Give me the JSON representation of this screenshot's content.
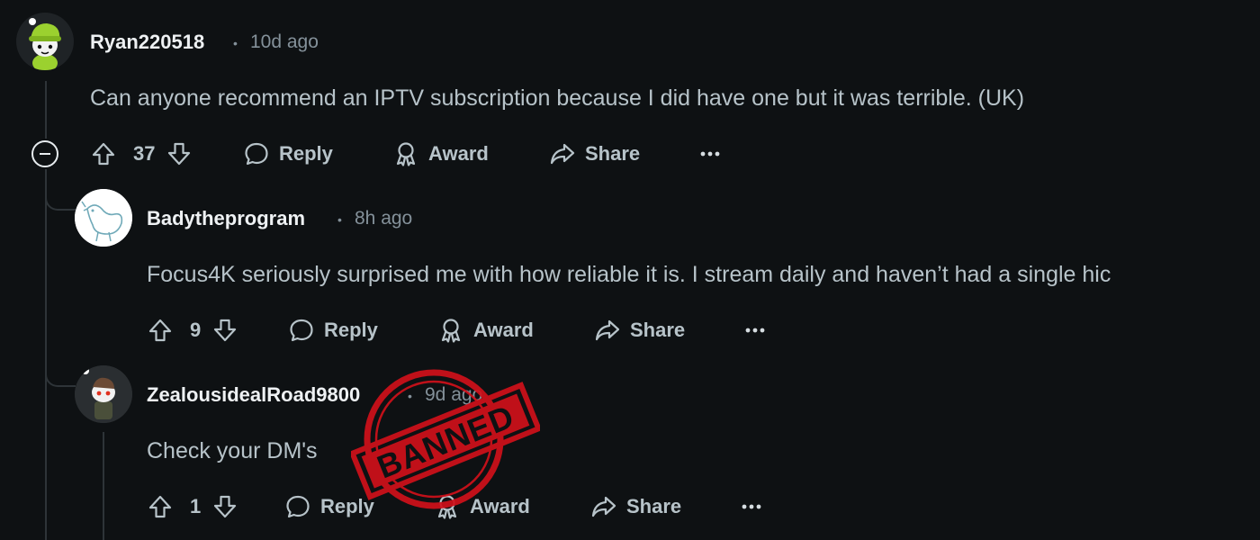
{
  "comments": [
    {
      "author": "Ryan220518",
      "separator": "•",
      "time": "10d ago",
      "body": "Can anyone recommend an IPTV subscription because I did have one but it was terrible. (UK)",
      "votes": "37",
      "actions": {
        "reply": "Reply",
        "award": "Award",
        "share": "Share"
      }
    },
    {
      "author": "Badytheprogram",
      "separator": "•",
      "time": "8h ago",
      "body": "Focus4K seriously surprised me with how reliable it is. I stream daily and haven’t had a single hic",
      "votes": "9",
      "actions": {
        "reply": "Reply",
        "award": "Award",
        "share": "Share"
      }
    },
    {
      "author": "ZealousidealRoad9800",
      "separator": "•",
      "time": "9d ago",
      "body": "Check your DM's",
      "votes": "1",
      "actions": {
        "reply": "Reply",
        "award": "Award",
        "share": "Share"
      }
    }
  ],
  "stamp": {
    "text": "BANNED",
    "color": "#d0101a"
  },
  "colors": {
    "background": "#0e1113",
    "text": "#b7c3c9",
    "muted": "#84919a",
    "author": "#eef1f3",
    "thread": "#2e3438"
  }
}
